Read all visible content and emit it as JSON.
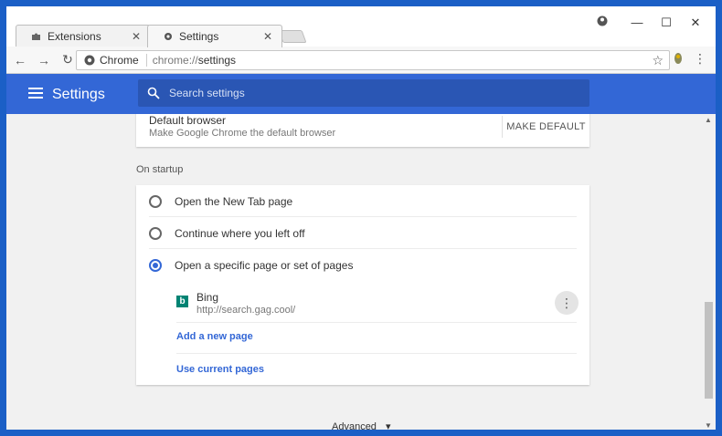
{
  "tabs": [
    {
      "label": "Extensions",
      "icon": "puzzle-icon",
      "active": false
    },
    {
      "label": "Settings",
      "icon": "gear-icon",
      "active": true
    }
  ],
  "window_controls": {
    "account": "●",
    "minimize": "—",
    "maximize": "☐",
    "close": "✕"
  },
  "toolbar": {
    "back": "←",
    "forward": "→",
    "reload": "↻",
    "site_label": "Chrome",
    "url_scheme": "chrome://",
    "url_path": "settings",
    "star": "☆",
    "menu": "⋮"
  },
  "header": {
    "title": "Settings",
    "search_placeholder": "Search settings"
  },
  "default_browser": {
    "title": "Default browser",
    "subtitle": "Make Google Chrome the default browser",
    "button": "MAKE DEFAULT"
  },
  "on_startup": {
    "label": "On startup",
    "options": [
      {
        "label": "Open the New Tab page",
        "checked": false
      },
      {
        "label": "Continue where you left off",
        "checked": false
      },
      {
        "label": "Open a specific page or set of pages",
        "checked": true
      }
    ],
    "pages": [
      {
        "name": "Bing",
        "url": "http://search.gag.cool/",
        "icon": "bing-icon"
      }
    ],
    "add_page": "Add a new page",
    "use_current": "Use current pages"
  },
  "advanced": {
    "label": "Advanced",
    "chevron": "▾"
  },
  "colors": {
    "header": "#3367d6",
    "accent": "#3367d6",
    "frame": "#1b5fc6"
  }
}
